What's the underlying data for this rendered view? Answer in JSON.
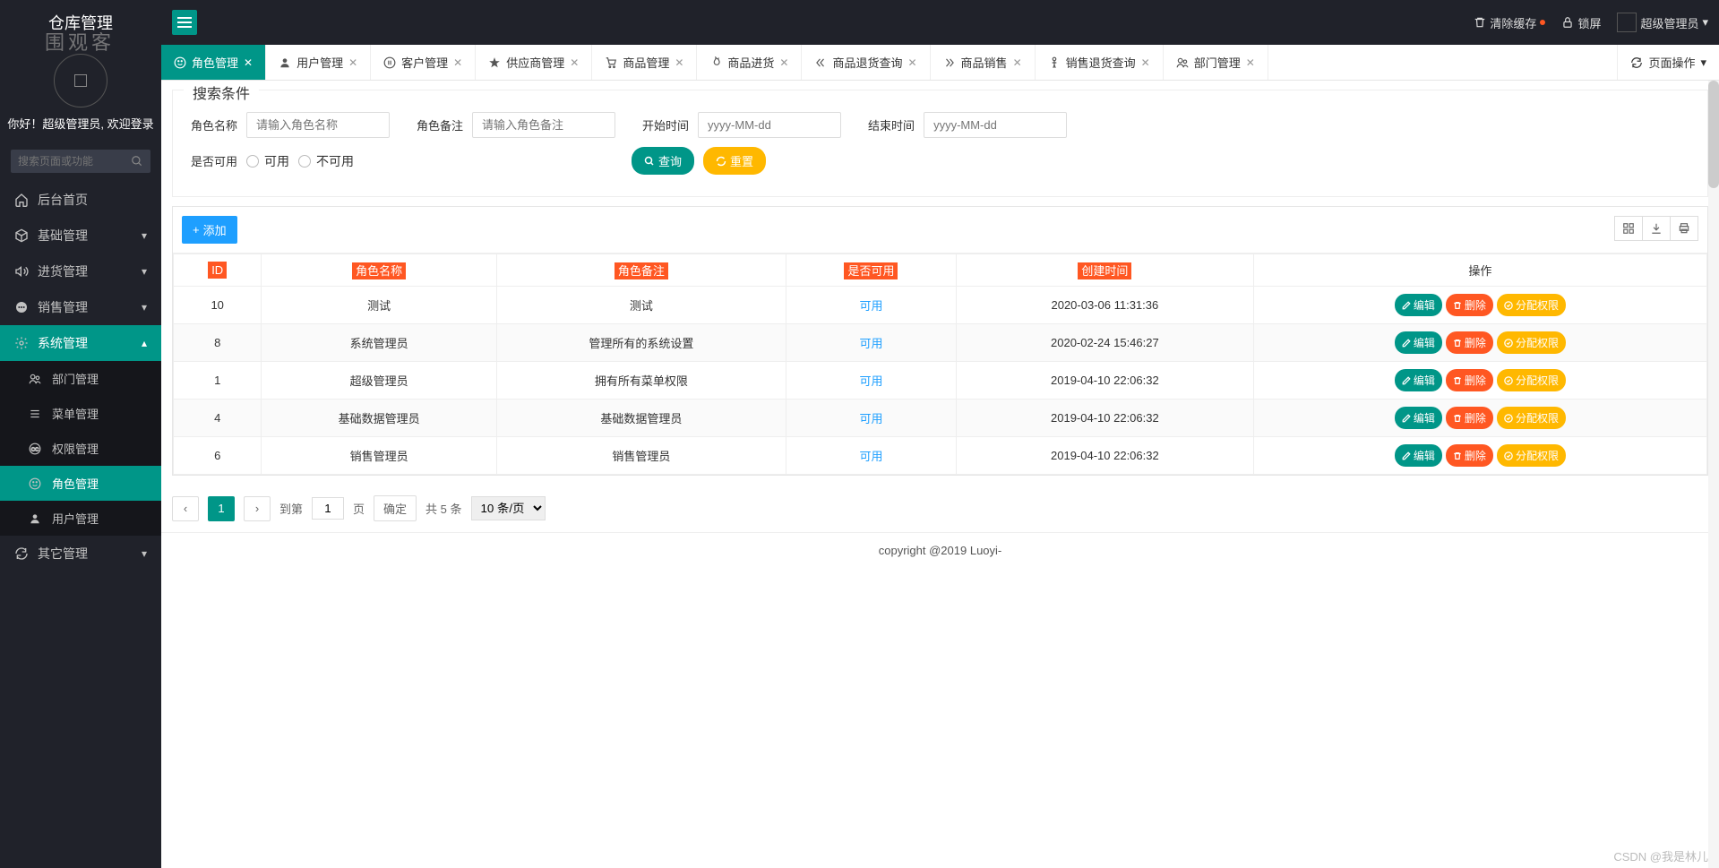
{
  "header": {
    "title": "仓库管理",
    "clear_cache": "清除缓存",
    "lock_screen": "锁屏",
    "user_menu": "超级管理员"
  },
  "watermark_logo": "围观客",
  "sidebar": {
    "welcome": "你好！超级管理员, 欢迎登录",
    "search_placeholder": "搜索页面或功能",
    "items": [
      {
        "label": "后台首页",
        "icon": "home"
      },
      {
        "label": "基础管理",
        "icon": "cube",
        "chev": "▾"
      },
      {
        "label": "进货管理",
        "icon": "sound",
        "chev": "▾"
      },
      {
        "label": "销售管理",
        "icon": "chat",
        "chev": "▾"
      },
      {
        "label": "系统管理",
        "icon": "gear",
        "chev": "▴",
        "expanded": true,
        "sub": [
          {
            "label": "部门管理",
            "icon": "users"
          },
          {
            "label": "菜单管理",
            "icon": "list"
          },
          {
            "label": "权限管理",
            "icon": "cc"
          },
          {
            "label": "角色管理",
            "icon": "smile",
            "current": true
          },
          {
            "label": "用户管理",
            "icon": "user"
          }
        ]
      },
      {
        "label": "其它管理",
        "icon": "refresh",
        "chev": "▾"
      }
    ]
  },
  "tabs": [
    {
      "label": "角色管理",
      "icon": "smile",
      "active": true
    },
    {
      "label": "用户管理",
      "icon": "user"
    },
    {
      "label": "客户管理",
      "icon": "pause"
    },
    {
      "label": "供应商管理",
      "icon": "star"
    },
    {
      "label": "商品管理",
      "icon": "cart"
    },
    {
      "label": "商品进货",
      "icon": "fire"
    },
    {
      "label": "商品退货查询",
      "icon": "dchev"
    },
    {
      "label": "商品销售",
      "icon": "arrow-r"
    },
    {
      "label": "销售退货查询",
      "icon": "man"
    },
    {
      "label": "部门管理",
      "icon": "users"
    }
  ],
  "tabs_right": "页面操作",
  "search": {
    "legend": "搜索条件",
    "role_name_label": "角色名称",
    "role_name_placeholder": "请输入角色名称",
    "role_remark_label": "角色备注",
    "role_remark_placeholder": "请输入角色备注",
    "start_time_label": "开始时间",
    "start_time_placeholder": "yyyy-MM-dd",
    "end_time_label": "结束时间",
    "end_time_placeholder": "yyyy-MM-dd",
    "available_label": "是否可用",
    "opt_available": "可用",
    "opt_unavailable": "不可用",
    "btn_query": "查询",
    "btn_reset": "重置"
  },
  "table": {
    "add_button": "添加",
    "headers": [
      "ID",
      "角色名称",
      "角色备注",
      "是否可用",
      "创建时间",
      "操作"
    ],
    "rows": [
      {
        "id": "10",
        "name": "测试",
        "remark": "测试",
        "avail": "可用",
        "time": "2020-03-06 11:31:36"
      },
      {
        "id": "8",
        "name": "系统管理员",
        "remark": "管理所有的系统设置",
        "avail": "可用",
        "time": "2020-02-24 15:46:27"
      },
      {
        "id": "1",
        "name": "超级管理员",
        "remark": "拥有所有菜单权限",
        "avail": "可用",
        "time": "2019-04-10 22:06:32"
      },
      {
        "id": "4",
        "name": "基础数据管理员",
        "remark": "基础数据管理员",
        "avail": "可用",
        "time": "2019-04-10 22:06:32"
      },
      {
        "id": "6",
        "name": "销售管理员",
        "remark": "销售管理员",
        "avail": "可用",
        "time": "2019-04-10 22:06:32"
      }
    ],
    "row_actions": {
      "edit": "编辑",
      "delete": "删除",
      "assign": "分配权限"
    }
  },
  "pagination": {
    "current_page": "1",
    "goto_label": "到第",
    "page_input": "1",
    "page_label": "页",
    "confirm": "确定",
    "total_label": "共 5 条",
    "per_page": "10 条/页"
  },
  "footer": "copyright @2019 Luoyi-",
  "watermark_br": "CSDN @我是林儿"
}
